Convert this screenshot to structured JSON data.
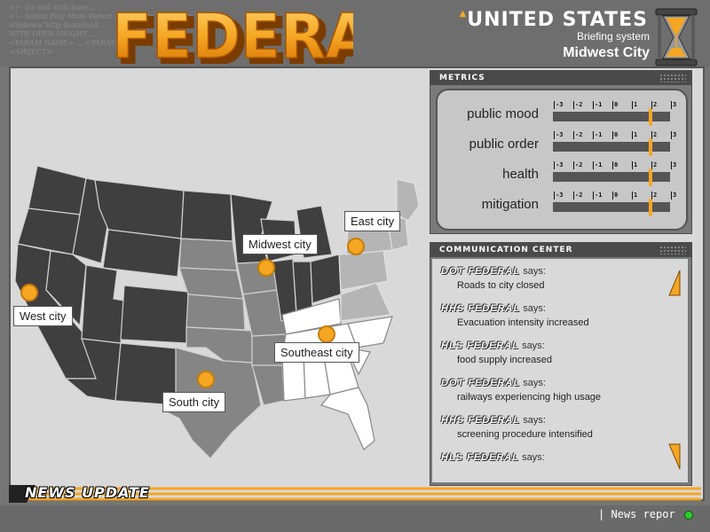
{
  "header": {
    "background_text": "<!-- for and with have... \n<!-- Sound Play Mute Parent ... program page Skip it\nwindow=\"http download ... \nWITH OPEN HEIGHT ...\n<PARAM NAME> ... <PARAM NAME>\n</OBJECT>",
    "logo_text": "FEDERAL",
    "title": "UNITED STATES",
    "subtitle": "Briefing system",
    "city": "Midwest City"
  },
  "map": {
    "cities": [
      {
        "label": "West city"
      },
      {
        "label": "Midwest city"
      },
      {
        "label": "East city"
      },
      {
        "label": "Southeast city"
      },
      {
        "label": "South city"
      }
    ]
  },
  "metrics": {
    "title": "METRICS",
    "ticks": [
      "-3",
      "-2",
      "-1",
      "0",
      "1",
      "2",
      "3"
    ],
    "items": [
      {
        "label": "public mood",
        "value": 2.0
      },
      {
        "label": "public order",
        "value": 2.0
      },
      {
        "label": "health",
        "value": 2.0
      },
      {
        "label": "mitigation",
        "value": 2.0
      }
    ]
  },
  "comm": {
    "title": "COMMUNICATION CENTER",
    "says": "says:",
    "messages": [
      {
        "agency": "DOT FEDERAL",
        "text": "Roads to city closed"
      },
      {
        "agency": "HHS FEDERAL",
        "text": "Evacuation intensity increased"
      },
      {
        "agency": "HLS FEDERAL",
        "text": "food supply increased"
      },
      {
        "agency": "DOT FEDERAL",
        "text": "railways experiencing high usage"
      },
      {
        "agency": "HHS FEDERAL",
        "text": "screening procedure intensified"
      },
      {
        "agency": "HLS FEDERAL",
        "text": ""
      }
    ]
  },
  "news": {
    "title": "NEWS UPDATE",
    "ticker": "| News repor"
  },
  "colors": {
    "accent": "#f5a623",
    "panel": "#d9d9d9",
    "status_led": "#2ecc2e"
  }
}
